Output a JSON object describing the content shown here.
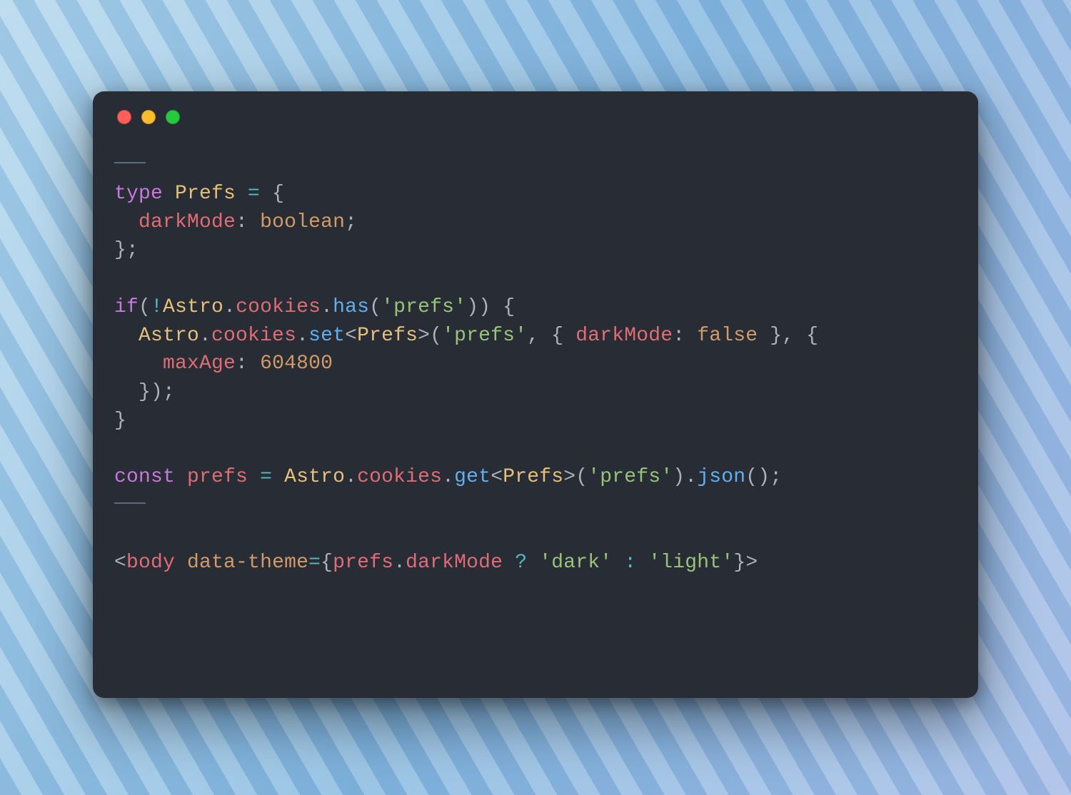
{
  "theme": {
    "editor_bg": "#282c34",
    "fg": "#abb2bf",
    "keyword": "#c678dd",
    "type": "#e5c07b",
    "number": "#d19a66",
    "property": "#e06c75",
    "function": "#61afef",
    "string": "#98c379",
    "operator": "#56b6c2",
    "traffic_red": "#ff5f56",
    "traffic_yellow": "#ffbd2e",
    "traffic_green": "#27c93f"
  },
  "code": {
    "lines": [
      [
        {
          "t": "---",
          "c": "fence"
        }
      ],
      [
        {
          "t": "type ",
          "c": "kw"
        },
        {
          "t": "Prefs",
          "c": "type"
        },
        {
          "t": " ",
          "c": "pun"
        },
        {
          "t": "=",
          "c": "op"
        },
        {
          "t": " {",
          "c": "pun"
        }
      ],
      [
        {
          "t": "  ",
          "c": "pun"
        },
        {
          "t": "darkMode",
          "c": "prop"
        },
        {
          "t": ": ",
          "c": "pun"
        },
        {
          "t": "boolean",
          "c": "bool"
        },
        {
          "t": ";",
          "c": "pun"
        }
      ],
      [
        {
          "t": "};",
          "c": "pun"
        }
      ],
      [],
      [
        {
          "t": "if",
          "c": "kw"
        },
        {
          "t": "(",
          "c": "pun"
        },
        {
          "t": "!",
          "c": "op"
        },
        {
          "t": "Astro",
          "c": "type"
        },
        {
          "t": ".",
          "c": "pun"
        },
        {
          "t": "cookies",
          "c": "prop"
        },
        {
          "t": ".",
          "c": "pun"
        },
        {
          "t": "has",
          "c": "fn"
        },
        {
          "t": "(",
          "c": "pun"
        },
        {
          "t": "'prefs'",
          "c": "str"
        },
        {
          "t": ")) {",
          "c": "pun"
        }
      ],
      [
        {
          "t": "  ",
          "c": "pun"
        },
        {
          "t": "Astro",
          "c": "type"
        },
        {
          "t": ".",
          "c": "pun"
        },
        {
          "t": "cookies",
          "c": "prop"
        },
        {
          "t": ".",
          "c": "pun"
        },
        {
          "t": "set",
          "c": "fn"
        },
        {
          "t": "<",
          "c": "pun"
        },
        {
          "t": "Prefs",
          "c": "type"
        },
        {
          "t": ">(",
          "c": "pun"
        },
        {
          "t": "'prefs'",
          "c": "str"
        },
        {
          "t": ", { ",
          "c": "pun"
        },
        {
          "t": "darkMode",
          "c": "prop"
        },
        {
          "t": ": ",
          "c": "pun"
        },
        {
          "t": "false",
          "c": "bool"
        },
        {
          "t": " }, {",
          "c": "pun"
        }
      ],
      [
        {
          "t": "    ",
          "c": "pun"
        },
        {
          "t": "maxAge",
          "c": "prop"
        },
        {
          "t": ": ",
          "c": "pun"
        },
        {
          "t": "604800",
          "c": "num"
        }
      ],
      [
        {
          "t": "  });",
          "c": "pun"
        }
      ],
      [
        {
          "t": "}",
          "c": "pun"
        }
      ],
      [],
      [
        {
          "t": "const ",
          "c": "kw"
        },
        {
          "t": "prefs",
          "c": "var"
        },
        {
          "t": " ",
          "c": "pun"
        },
        {
          "t": "=",
          "c": "op"
        },
        {
          "t": " ",
          "c": "pun"
        },
        {
          "t": "Astro",
          "c": "type"
        },
        {
          "t": ".",
          "c": "pun"
        },
        {
          "t": "cookies",
          "c": "prop"
        },
        {
          "t": ".",
          "c": "pun"
        },
        {
          "t": "get",
          "c": "fn"
        },
        {
          "t": "<",
          "c": "pun"
        },
        {
          "t": "Prefs",
          "c": "type"
        },
        {
          "t": ">(",
          "c": "pun"
        },
        {
          "t": "'prefs'",
          "c": "str"
        },
        {
          "t": ").",
          "c": "pun"
        },
        {
          "t": "json",
          "c": "fn"
        },
        {
          "t": "();",
          "c": "pun"
        }
      ],
      [
        {
          "t": "---",
          "c": "fence"
        }
      ],
      [],
      [
        {
          "t": "<",
          "c": "pun"
        },
        {
          "t": "body",
          "c": "tag"
        },
        {
          "t": " ",
          "c": "pun"
        },
        {
          "t": "data-theme",
          "c": "attr"
        },
        {
          "t": "=",
          "c": "op"
        },
        {
          "t": "{",
          "c": "pun"
        },
        {
          "t": "prefs",
          "c": "var"
        },
        {
          "t": ".",
          "c": "pun"
        },
        {
          "t": "darkMode",
          "c": "prop"
        },
        {
          "t": " ",
          "c": "pun"
        },
        {
          "t": "?",
          "c": "op"
        },
        {
          "t": " ",
          "c": "pun"
        },
        {
          "t": "'dark'",
          "c": "str"
        },
        {
          "t": " ",
          "c": "pun"
        },
        {
          "t": ":",
          "c": "op"
        },
        {
          "t": " ",
          "c": "pun"
        },
        {
          "t": "'light'",
          "c": "str"
        },
        {
          "t": "}>",
          "c": "pun"
        }
      ]
    ]
  }
}
